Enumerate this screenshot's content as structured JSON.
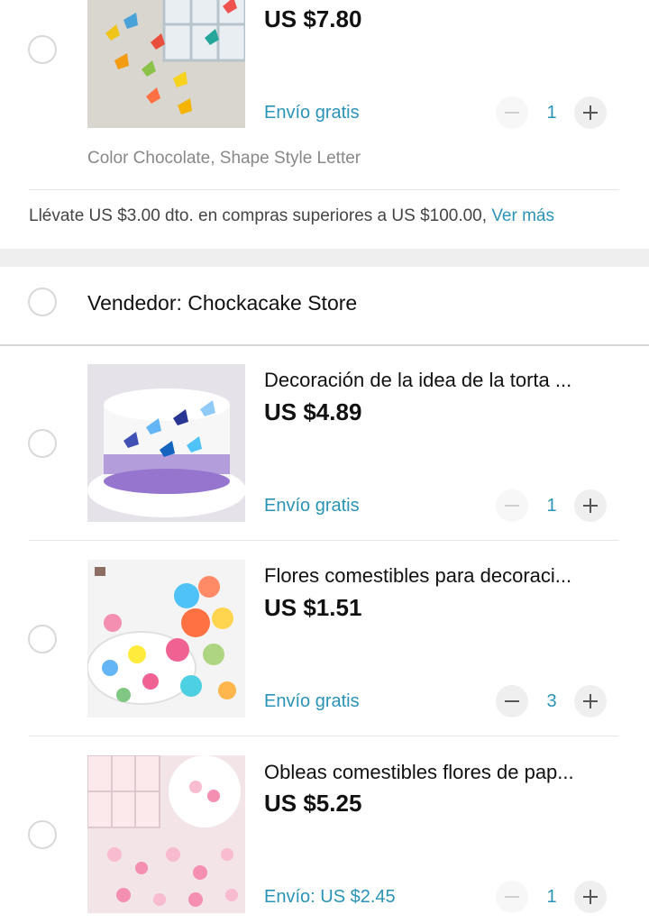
{
  "first_store": {
    "item": {
      "price": "US $7.80",
      "shipping": "Envío gratis",
      "quantity": "1",
      "variant": "Color Chocolate, Shape Style Letter"
    },
    "promo": {
      "text": "Llévate US $3.00 dto. en compras superiores a US $100.00, ",
      "link": "Ver más"
    }
  },
  "second_store": {
    "seller_label": "Vendedor: Chockacake Store",
    "items": [
      {
        "title": "Decoración de la idea de la torta ...",
        "price": "US $4.89",
        "shipping": "Envío gratis",
        "quantity": "1"
      },
      {
        "title": "Flores comestibles para decoraci...",
        "price": "US $1.51",
        "shipping": "Envío gratis",
        "quantity": "3"
      },
      {
        "title": "Obleas comestibles flores de pap...",
        "price": "US $5.25",
        "shipping": "Envío: US $2.45",
        "quantity": "1"
      }
    ]
  },
  "colors": {
    "accent": "#2a93b8",
    "background": "#efefef"
  }
}
